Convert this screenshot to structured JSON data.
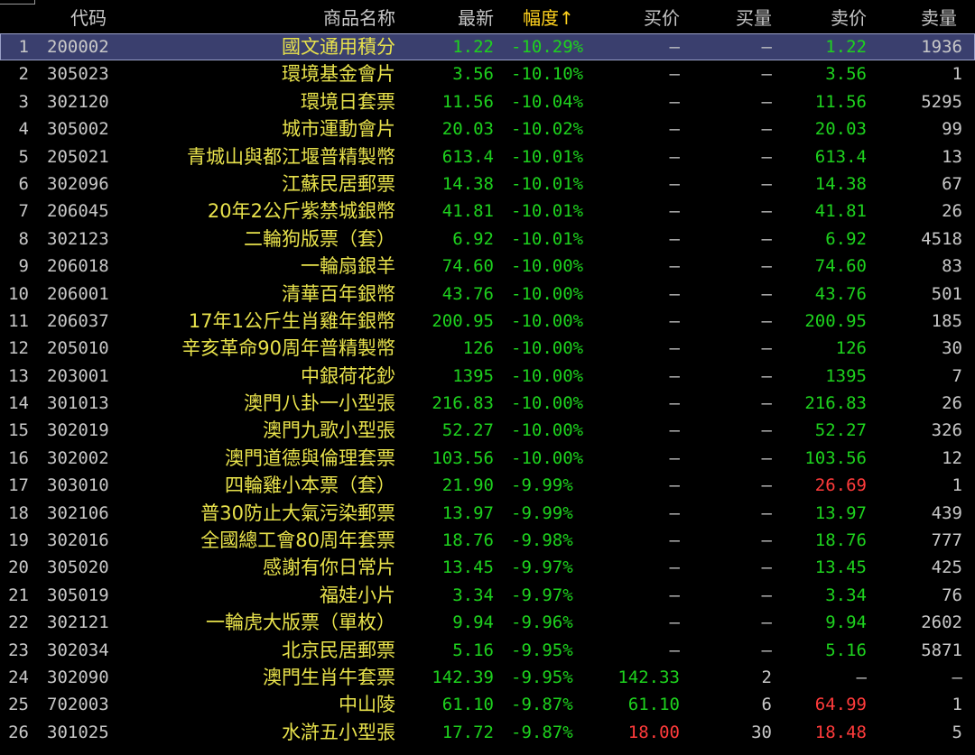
{
  "header": {
    "code": "代码",
    "name": "商品名称",
    "last": "最新",
    "change": "幅度↑",
    "bid": "买价",
    "bid_vol": "买量",
    "ask": "卖价",
    "ask_vol": "卖量"
  },
  "colors": {
    "up": "#ff3b3b",
    "down": "#1ed21e",
    "name": "#e8e24c",
    "sort_header": "#ffd21e",
    "selected_row": "#3a3f6e"
  },
  "rows": [
    {
      "idx": "1",
      "code": "200002",
      "name": "國文通用積分",
      "last": "1.22",
      "chg": "-10.29%",
      "bid": "—",
      "bid_vol": "—",
      "ask": "1.22",
      "ask_vol": "1936"
    },
    {
      "idx": "2",
      "code": "305023",
      "name": "環境基金會片",
      "last": "3.56",
      "chg": "-10.10%",
      "bid": "—",
      "bid_vol": "—",
      "ask": "3.56",
      "ask_vol": "1"
    },
    {
      "idx": "3",
      "code": "302120",
      "name": "環境日套票",
      "last": "11.56",
      "chg": "-10.04%",
      "bid": "—",
      "bid_vol": "—",
      "ask": "11.56",
      "ask_vol": "5295"
    },
    {
      "idx": "4",
      "code": "305002",
      "name": "城市運動會片",
      "last": "20.03",
      "chg": "-10.02%",
      "bid": "—",
      "bid_vol": "—",
      "ask": "20.03",
      "ask_vol": "99"
    },
    {
      "idx": "5",
      "code": "205021",
      "name": "青城山與都江堰普精製幣",
      "last": "613.4",
      "chg": "-10.01%",
      "bid": "—",
      "bid_vol": "—",
      "ask": "613.4",
      "ask_vol": "13"
    },
    {
      "idx": "6",
      "code": "302096",
      "name": "江蘇民居郵票",
      "last": "14.38",
      "chg": "-10.01%",
      "bid": "—",
      "bid_vol": "—",
      "ask": "14.38",
      "ask_vol": "67"
    },
    {
      "idx": "7",
      "code": "206045",
      "name": "20年2公斤紫禁城銀幣",
      "last": "41.81",
      "chg": "-10.01%",
      "bid": "—",
      "bid_vol": "—",
      "ask": "41.81",
      "ask_vol": "26"
    },
    {
      "idx": "8",
      "code": "302123",
      "name": "二輪狗版票（套）",
      "last": "6.92",
      "chg": "-10.01%",
      "bid": "—",
      "bid_vol": "—",
      "ask": "6.92",
      "ask_vol": "4518"
    },
    {
      "idx": "9",
      "code": "206018",
      "name": "一輪扇銀羊",
      "last": "74.60",
      "chg": "-10.00%",
      "bid": "—",
      "bid_vol": "—",
      "ask": "74.60",
      "ask_vol": "83"
    },
    {
      "idx": "10",
      "code": "206001",
      "name": "清華百年銀幣",
      "last": "43.76",
      "chg": "-10.00%",
      "bid": "—",
      "bid_vol": "—",
      "ask": "43.76",
      "ask_vol": "501"
    },
    {
      "idx": "11",
      "code": "206037",
      "name": "17年1公斤生肖雞年銀幣",
      "last": "200.95",
      "chg": "-10.00%",
      "bid": "—",
      "bid_vol": "—",
      "ask": "200.95",
      "ask_vol": "185"
    },
    {
      "idx": "12",
      "code": "205010",
      "name": "辛亥革命90周年普精製幣",
      "last": "126",
      "chg": "-10.00%",
      "bid": "—",
      "bid_vol": "—",
      "ask": "126",
      "ask_vol": "30"
    },
    {
      "idx": "13",
      "code": "203001",
      "name": "中銀荷花鈔",
      "last": "1395",
      "chg": "-10.00%",
      "bid": "—",
      "bid_vol": "—",
      "ask": "1395",
      "ask_vol": "7"
    },
    {
      "idx": "14",
      "code": "301013",
      "name": "澳門八卦一小型張",
      "last": "216.83",
      "chg": "-10.00%",
      "bid": "—",
      "bid_vol": "—",
      "ask": "216.83",
      "ask_vol": "26"
    },
    {
      "idx": "15",
      "code": "302019",
      "name": "澳門九歌小型張",
      "last": "52.27",
      "chg": "-10.00%",
      "bid": "—",
      "bid_vol": "—",
      "ask": "52.27",
      "ask_vol": "326"
    },
    {
      "idx": "16",
      "code": "302002",
      "name": "澳門道德與倫理套票",
      "last": "103.56",
      "chg": "-10.00%",
      "bid": "—",
      "bid_vol": "—",
      "ask": "103.56",
      "ask_vol": "12"
    },
    {
      "idx": "17",
      "code": "303010",
      "name": "四輪雞小本票（套）",
      "last": "21.90",
      "chg": "-9.99%",
      "bid": "—",
      "bid_vol": "—",
      "ask": "26.69",
      "ask_vol": "1",
      "ask_up": true
    },
    {
      "idx": "18",
      "code": "302106",
      "name": "普30防止大氣污染郵票",
      "last": "13.97",
      "chg": "-9.99%",
      "bid": "—",
      "bid_vol": "—",
      "ask": "13.97",
      "ask_vol": "439"
    },
    {
      "idx": "19",
      "code": "302016",
      "name": "全國總工會80周年套票",
      "last": "18.76",
      "chg": "-9.98%",
      "bid": "—",
      "bid_vol": "—",
      "ask": "18.76",
      "ask_vol": "777"
    },
    {
      "idx": "20",
      "code": "305020",
      "name": "感謝有你日常片",
      "last": "13.45",
      "chg": "-9.97%",
      "bid": "—",
      "bid_vol": "—",
      "ask": "13.45",
      "ask_vol": "425"
    },
    {
      "idx": "21",
      "code": "305019",
      "name": "福娃小片",
      "last": "3.34",
      "chg": "-9.97%",
      "bid": "—",
      "bid_vol": "—",
      "ask": "3.34",
      "ask_vol": "76"
    },
    {
      "idx": "22",
      "code": "302121",
      "name": "一輪虎大版票（單枚）",
      "last": "9.94",
      "chg": "-9.96%",
      "bid": "—",
      "bid_vol": "—",
      "ask": "9.94",
      "ask_vol": "2602"
    },
    {
      "idx": "23",
      "code": "302034",
      "name": "北京民居郵票",
      "last": "5.16",
      "chg": "-9.95%",
      "bid": "—",
      "bid_vol": "—",
      "ask": "5.16",
      "ask_vol": "5871"
    },
    {
      "idx": "24",
      "code": "302090",
      "name": "澳門生肖牛套票",
      "last": "142.39",
      "chg": "-9.95%",
      "bid": "142.33",
      "bid_vol": "2",
      "ask": "—",
      "ask_vol": "—"
    },
    {
      "idx": "25",
      "code": "702003",
      "name": "中山陵",
      "last": "61.10",
      "chg": "-9.87%",
      "bid": "61.10",
      "bid_vol": "6",
      "ask": "64.99",
      "ask_vol": "1",
      "ask_up": true
    },
    {
      "idx": "26",
      "code": "301025",
      "name": "水滸五小型張",
      "last": "17.72",
      "chg": "-9.87%",
      "bid": "18.00",
      "bid_vol": "30",
      "ask": "18.48",
      "ask_vol": "5",
      "bid_up": true,
      "ask_up": true
    }
  ]
}
